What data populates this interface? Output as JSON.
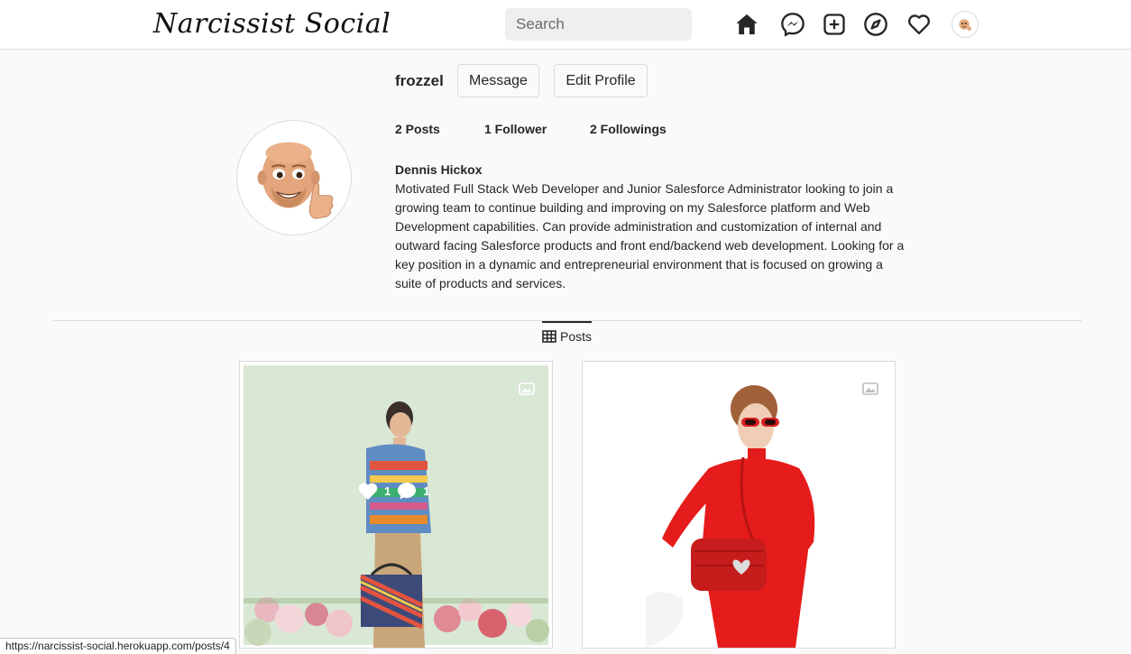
{
  "header": {
    "logo": "Narcissist Social",
    "search_placeholder": "Search",
    "icons": [
      "home-icon",
      "messenger-icon",
      "new-post-icon",
      "explore-icon",
      "activity-heart-icon",
      "profile-avatar"
    ]
  },
  "profile": {
    "username": "frozzel",
    "message_label": "Message",
    "edit_label": "Edit Profile",
    "posts_count": "2 Posts",
    "followers": "1 Follower",
    "followings": "2 Followings",
    "full_name": "Dennis Hickox",
    "bio": "Motivated Full Stack Web Developer and Junior Salesforce Administrator looking to join a growing team to continue building and improving on my Salesforce platform and Web Development capabilities. Can provide administration and customization of internal and outward facing Salesforce products and front end/backend web development. Looking for a key position in a dynamic and entrepreneurial environment that is focused on growing a suite of products and services."
  },
  "tabs": {
    "posts_label": "Posts"
  },
  "posts": [
    {
      "likes": "1",
      "comments": "1",
      "type": "multiple-images"
    },
    {
      "type": "multiple-images"
    }
  ],
  "status_bar": {
    "url": "https://narcissist-social.herokuapp.com/posts/4"
  },
  "colors": {
    "border": "#dbdbdb",
    "background": "#fafafa",
    "text": "#262626"
  }
}
